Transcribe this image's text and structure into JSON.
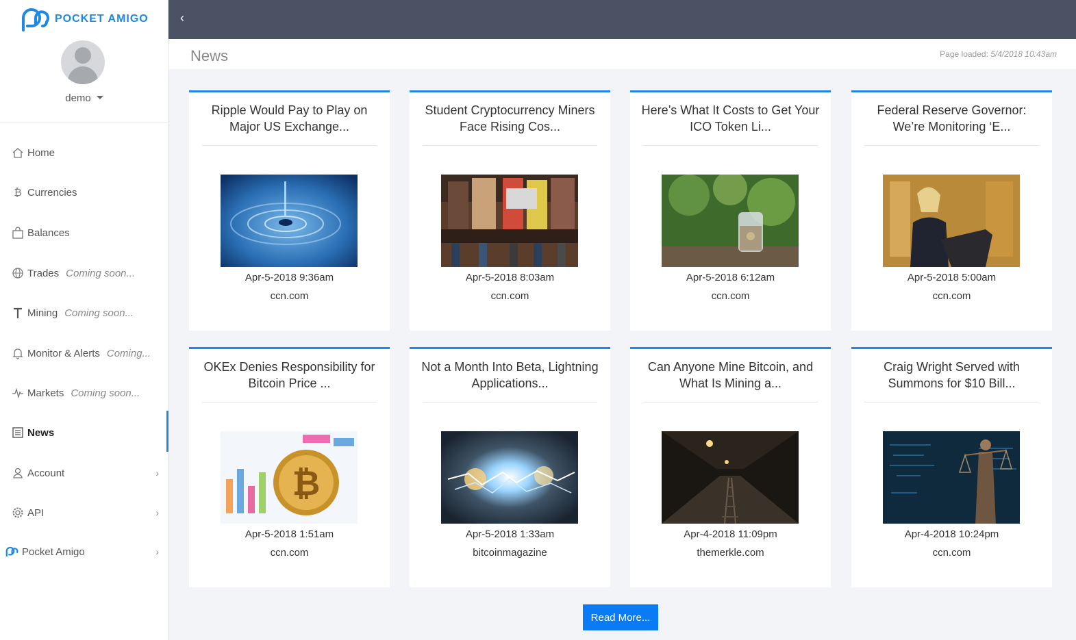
{
  "app": {
    "name": "POCKET AMIGO",
    "user": "demo"
  },
  "sidebar": {
    "items": [
      {
        "label": "Home",
        "soon": "",
        "icon": "home-icon"
      },
      {
        "label": "Currencies",
        "soon": "",
        "icon": "bitcoin-icon"
      },
      {
        "label": "Balances",
        "soon": "",
        "icon": "bag-icon"
      },
      {
        "label": "Trades",
        "soon": "Coming soon...",
        "icon": "globe-icon"
      },
      {
        "label": "Mining",
        "soon": "Coming soon...",
        "icon": "hammer-icon"
      },
      {
        "label": "Monitor & Alerts",
        "soon": "Coming...",
        "icon": "bell-icon"
      },
      {
        "label": "Markets",
        "soon": "Coming soon...",
        "icon": "pulse-icon"
      },
      {
        "label": "News",
        "soon": "",
        "icon": "newspaper-icon",
        "active": true
      },
      {
        "label": "Account",
        "soon": "",
        "icon": "user-icon",
        "submenu": true
      },
      {
        "label": "API",
        "soon": "",
        "icon": "gear-icon",
        "submenu": true
      },
      {
        "label": "Pocket Amigo",
        "soon": "",
        "icon": "logo-icon",
        "submenu": true
      }
    ]
  },
  "header": {
    "title": "News",
    "loaded_label": "Page loaded:",
    "loaded_time": "5/4/2018 10:43am"
  },
  "articles": [
    {
      "title": "Ripple Would Pay to Play on Major US Exchange...",
      "date": "Apr-5-2018 9:36am",
      "source": "ccn.com",
      "image": "water-drop"
    },
    {
      "title": "Student Cryptocurrency Miners Face Rising Cos...",
      "date": "Apr-5-2018 8:03am",
      "source": "ccn.com",
      "image": "students"
    },
    {
      "title": "Here’s What It Costs to Get Your ICO Token Li...",
      "date": "Apr-5-2018 6:12am",
      "source": "ccn.com",
      "image": "coin-jar"
    },
    {
      "title": "Federal Reserve Governor: We’re Monitoring ‘E...",
      "date": "Apr-5-2018 5:00am",
      "source": "ccn.com",
      "image": "speaker"
    },
    {
      "title": "OKEx Denies Responsibility for Bitcoin Price ...",
      "date": "Apr-5-2018 1:51am",
      "source": "ccn.com",
      "image": "bitcoin-chart"
    },
    {
      "title": "Not a Month Into Beta, Lightning Applications...",
      "date": "Apr-5-2018 1:33am",
      "source": "bitcoinmagazine",
      "image": "lightning"
    },
    {
      "title": "Can Anyone Mine Bitcoin, and What Is Mining a...",
      "date": "Apr-4-2018 11:09pm",
      "source": "themerkle.com",
      "image": "mine-tunnel"
    },
    {
      "title": "Craig Wright Served with Summons for $10 Bill...",
      "date": "Apr-4-2018 10:24pm",
      "source": "ccn.com",
      "image": "justice"
    }
  ],
  "read_more_label": "Read More...",
  "colors": {
    "accent": "#1e88e5",
    "topbar": "#4b5263",
    "button": "#0a7bf5"
  }
}
